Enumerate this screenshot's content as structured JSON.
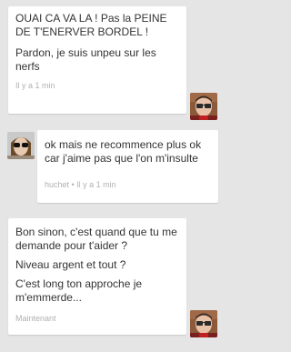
{
  "messages": [
    {
      "side": "right",
      "lines": [
        "OUAI CA VA LA ! Pas la PEINE DE T'ENERVER BORDEL !",
        "Pardon, je suis unpeu sur les nerfs"
      ],
      "meta": "Il y a 1 min",
      "avatar": "avatar-man-glasses"
    },
    {
      "side": "left",
      "lines": [
        "ok mais ne recommence plus ok car j'aime pas que l'on m'insulte"
      ],
      "meta": "huchet • Il y a 1 min",
      "avatar": "avatar-woman-sunglasses"
    },
    {
      "side": "right",
      "lines": [
        "Bon sinon, c'est quand que tu me demande pour t'aider ?",
        "Niveau argent et tout ?",
        "C'est long ton approche je m'emmerde..."
      ],
      "meta": "Maintenant",
      "avatar": "avatar-man-glasses"
    }
  ]
}
